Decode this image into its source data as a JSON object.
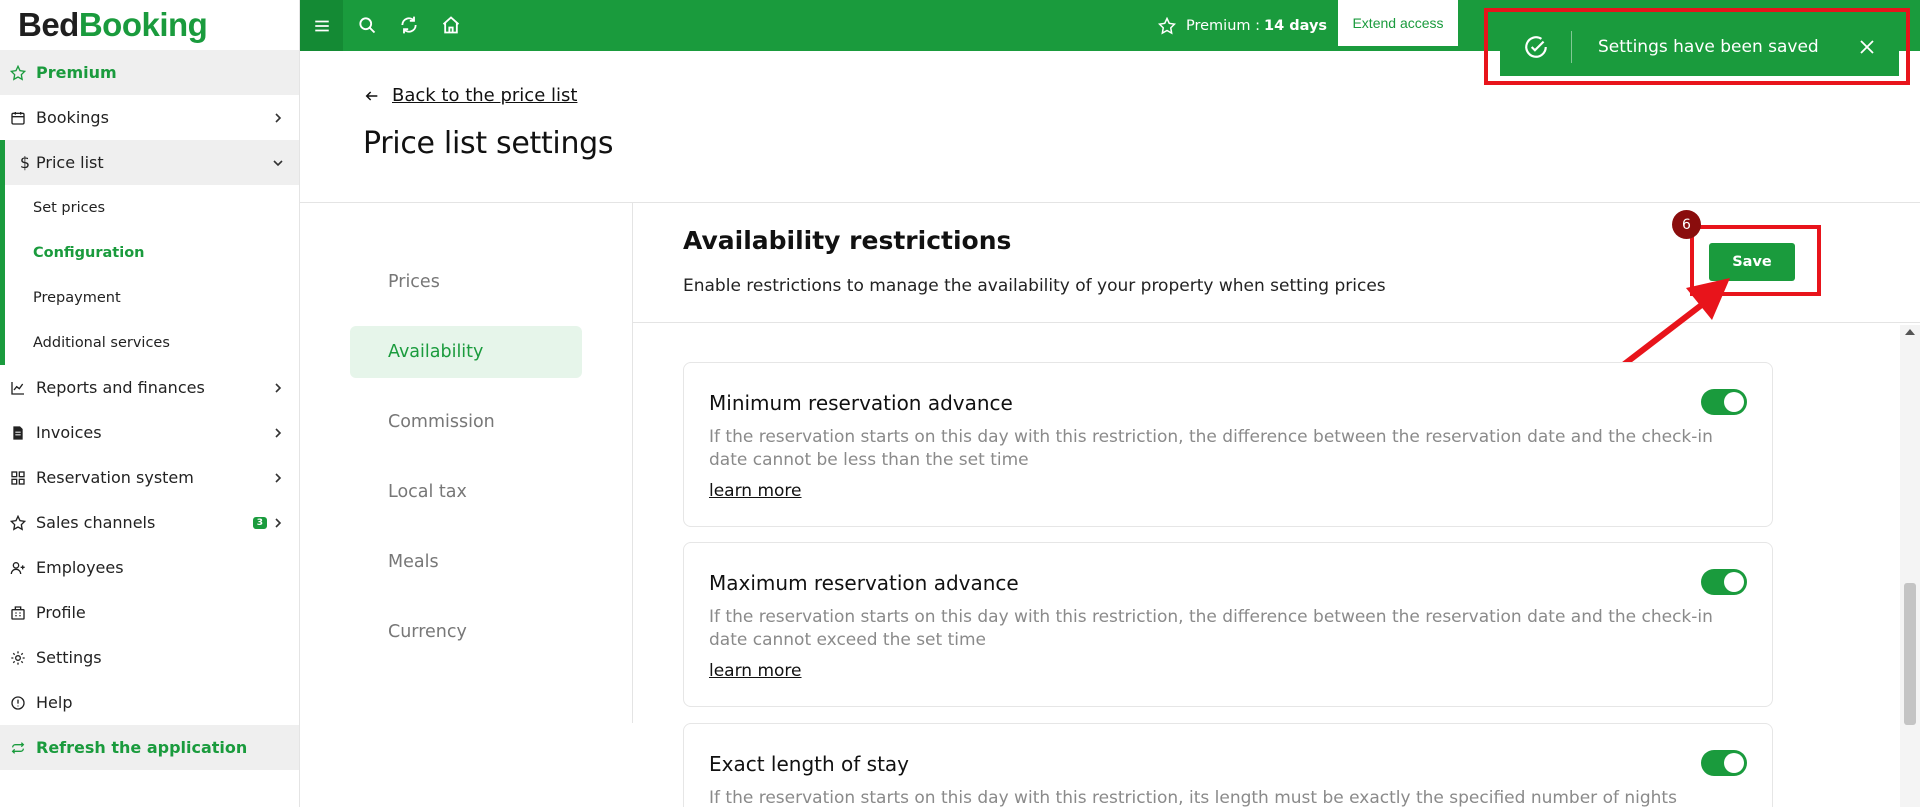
{
  "logo": {
    "part1": "Bed",
    "part2": "Booking"
  },
  "sidebar": {
    "premium": "Premium",
    "bookings": "Bookings",
    "price_list": "Price list",
    "sub_items": [
      "Set prices",
      "Configuration",
      "Prepayment",
      "Additional services"
    ],
    "reports": "Reports and finances",
    "invoices": "Invoices",
    "reservation_system": "Reservation system",
    "sales_channels": "Sales channels",
    "sales_channels_badge": "3",
    "employees": "Employees",
    "profile": "Profile",
    "settings": "Settings",
    "help": "Help",
    "refresh": "Refresh the application"
  },
  "topbar": {
    "premium_label": "Premium :",
    "premium_days": "14 days",
    "extend_label": "Extend access"
  },
  "toast": {
    "message": "Settings have been saved"
  },
  "header": {
    "back_label": "Back to the price list",
    "title": "Price list settings"
  },
  "settings_menu": [
    "Prices",
    "Availability",
    "Commission",
    "Local tax",
    "Meals",
    "Currency"
  ],
  "section": {
    "title": "Availability restrictions",
    "description": "Enable restrictions to manage the availability of your property when setting prices",
    "save_label": "Save",
    "step_number": "6"
  },
  "cards": [
    {
      "title": "Minimum reservation advance",
      "description": "If the reservation starts on this day with this restriction, the difference between the reservation date and the check-in date cannot be less than the set time",
      "link": "learn more",
      "enabled": true
    },
    {
      "title": "Maximum reservation advance",
      "description": "If the reservation starts on this day with this restriction, the difference between the reservation date and the check-in date cannot exceed the set time",
      "link": "learn more",
      "enabled": true
    },
    {
      "title": "Exact length of stay",
      "description": "If the reservation starts on this day with this restriction, its length must be exactly the specified number of nights",
      "link": "",
      "enabled": true
    }
  ],
  "colors": {
    "brand_green": "#1a9b3d",
    "annotation_red": "#e8141b",
    "step_badge": "#8a0d0d"
  }
}
